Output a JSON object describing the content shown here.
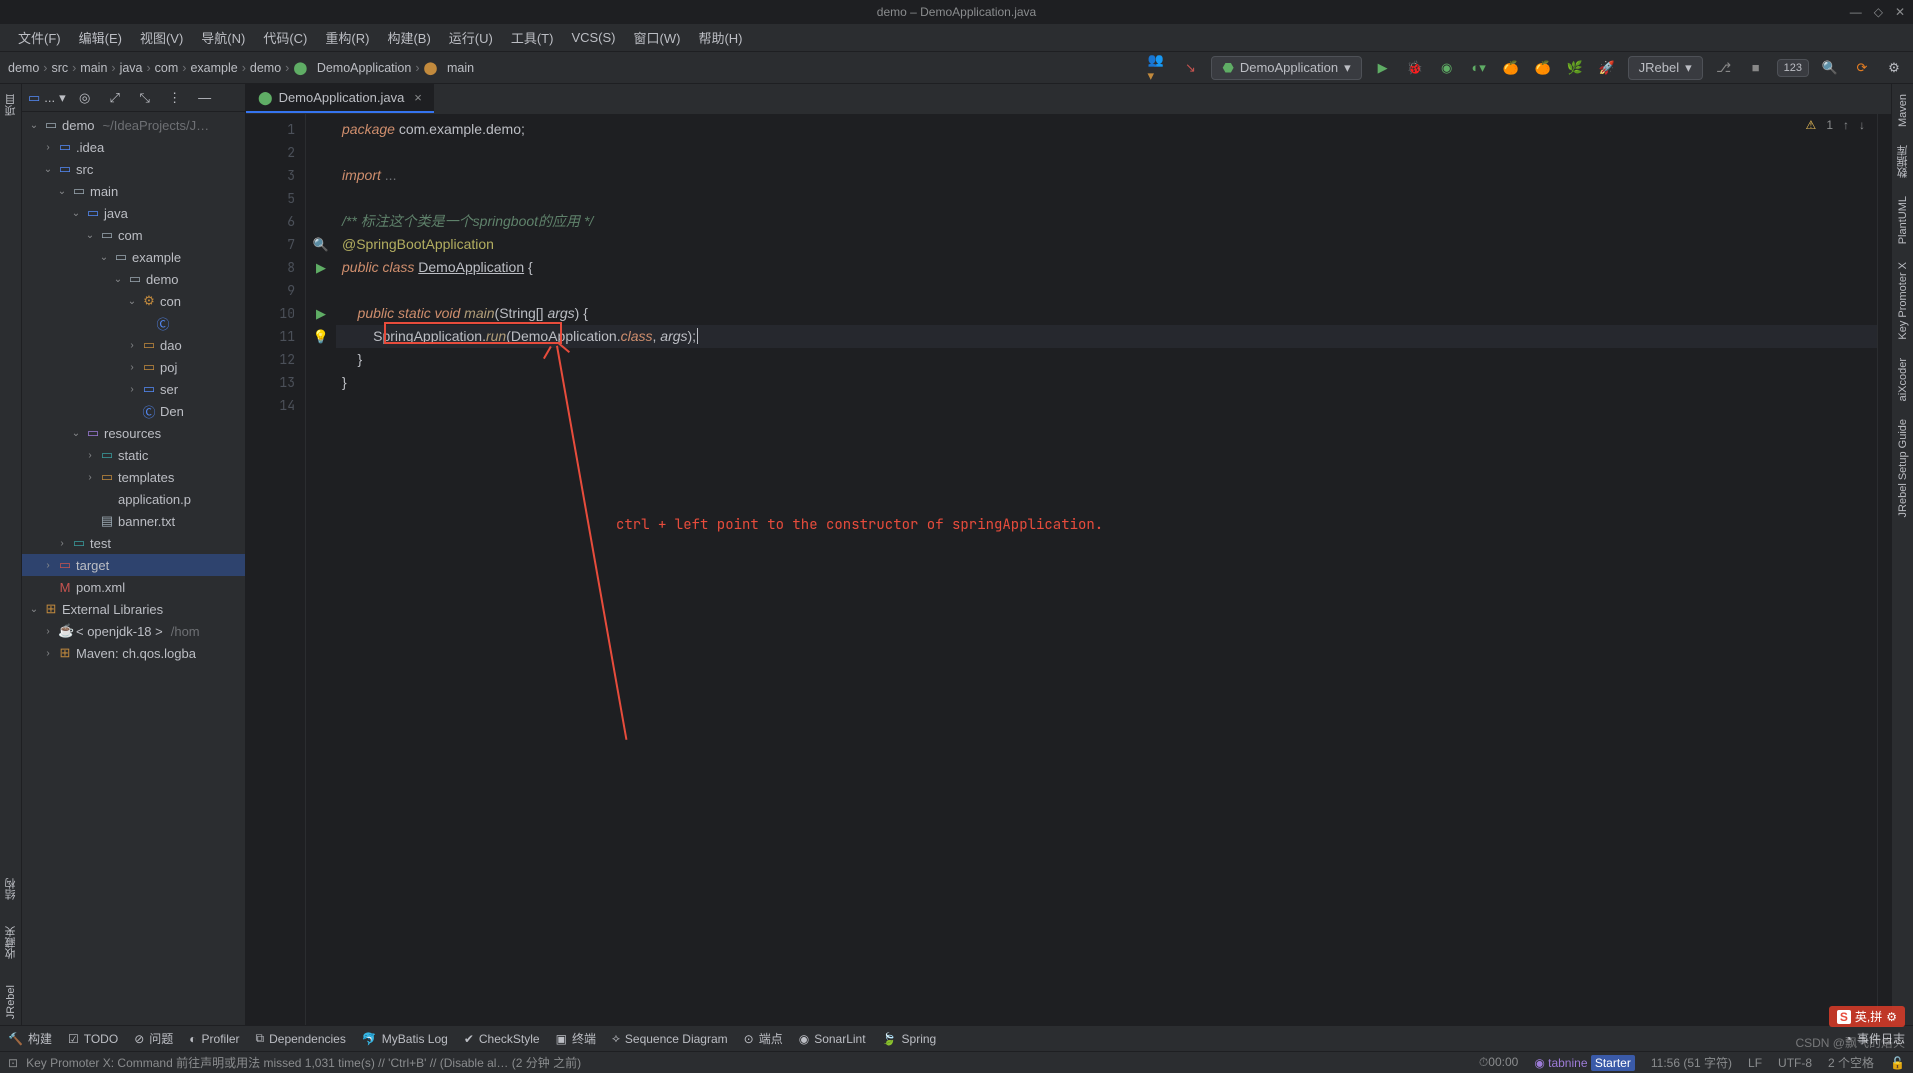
{
  "titlebar": {
    "title": "demo – DemoApplication.java"
  },
  "menu": {
    "file": "文件(F)",
    "edit": "编辑(E)",
    "view": "视图(V)",
    "navigate": "导航(N)",
    "code": "代码(C)",
    "refactor": "重构(R)",
    "build": "构建(B)",
    "run": "运行(U)",
    "tools": "工具(T)",
    "vcs": "VCS(S)",
    "window": "窗口(W)",
    "help": "帮助(H)"
  },
  "breadcrumb": {
    "items": [
      "demo",
      "src",
      "main",
      "java",
      "com",
      "example",
      "demo",
      "DemoApplication",
      "main"
    ]
  },
  "runconfig": {
    "label": "DemoApplication"
  },
  "jrebel": {
    "label": "JRebel"
  },
  "countbadge": {
    "value": "123"
  },
  "project": {
    "header_label": "...",
    "root": {
      "name": "demo",
      "path": "~/IdeaProjects/J…"
    },
    "tree": [
      {
        "indent": 1,
        "arrow": "›",
        "icon": "folder-blue",
        "label": ".idea"
      },
      {
        "indent": 1,
        "arrow": "⌄",
        "icon": "folder-blue",
        "label": "src"
      },
      {
        "indent": 2,
        "arrow": "⌄",
        "icon": "folder",
        "label": "main"
      },
      {
        "indent": 3,
        "arrow": "⌄",
        "icon": "folder-blue",
        "label": "java"
      },
      {
        "indent": 4,
        "arrow": "⌄",
        "icon": "folder",
        "label": "com"
      },
      {
        "indent": 5,
        "arrow": "⌄",
        "icon": "folder",
        "label": "example"
      },
      {
        "indent": 6,
        "arrow": "⌄",
        "icon": "folder",
        "label": "demo"
      },
      {
        "indent": 7,
        "arrow": "⌄",
        "icon": "gear",
        "label": "con"
      },
      {
        "indent": 8,
        "arrow": "",
        "icon": "class",
        "label": ""
      },
      {
        "indent": 7,
        "arrow": "›",
        "icon": "folder-orange",
        "label": "dao"
      },
      {
        "indent": 7,
        "arrow": "›",
        "icon": "folder-orange",
        "label": "poj"
      },
      {
        "indent": 7,
        "arrow": "›",
        "icon": "folder-blue",
        "label": "ser"
      },
      {
        "indent": 7,
        "arrow": "",
        "icon": "class",
        "label": "Den"
      },
      {
        "indent": 3,
        "arrow": "⌄",
        "icon": "folder-purple",
        "label": "resources"
      },
      {
        "indent": 4,
        "arrow": "›",
        "icon": "folder-teal",
        "label": "static"
      },
      {
        "indent": 4,
        "arrow": "›",
        "icon": "folder-orange",
        "label": "templates"
      },
      {
        "indent": 4,
        "arrow": "",
        "icon": "xml",
        "label": "application.p"
      },
      {
        "indent": 4,
        "arrow": "",
        "icon": "file",
        "label": "banner.txt"
      },
      {
        "indent": 2,
        "arrow": "›",
        "icon": "folder-teal",
        "label": "test"
      },
      {
        "indent": 1,
        "arrow": "›",
        "icon": "folder-red",
        "label": "target",
        "selected": true
      },
      {
        "indent": 1,
        "arrow": "",
        "icon": "maven",
        "label": "pom.xml"
      },
      {
        "indent": 0,
        "arrow": "⌄",
        "icon": "lib",
        "label": "External Libraries"
      },
      {
        "indent": 1,
        "arrow": "›",
        "icon": "jdk",
        "label": "< openjdk-18 >",
        "dim": "/hom"
      },
      {
        "indent": 1,
        "arrow": "›",
        "icon": "lib",
        "label": "Maven: ch.qos.logba"
      }
    ]
  },
  "left_stripe": {
    "project": "项目",
    "structure": "结构",
    "favorites": "收藏夹",
    "jrebel": "JRebel"
  },
  "right_stripe": {
    "maven": "Maven",
    "database": "数据库",
    "plantuml": "PlantUML",
    "keypromoter": "Key Promoter X",
    "aixcoder": "aiXcoder",
    "jrebel_setup": "JRebel Setup Guide"
  },
  "editor": {
    "tab_label": "DemoApplication.java",
    "lines": [
      "1",
      "2",
      "3",
      "5",
      "6",
      "7",
      "8",
      "9",
      "10",
      "11",
      "12",
      "13",
      "14"
    ],
    "warning_count": "1",
    "annotation_text": "ctrl + left point to the constructor of springApplication.",
    "code": {
      "l1_kw": "package",
      "l1_rest": " com.example.demo;",
      "l3_kw": "import",
      "l3_rest": " ...",
      "l6_comment": "/** 标注这个类是一个springboot的应用 */",
      "l7_anno": "@SpringBootApplication",
      "l8_a": "public",
      "l8_b": " class ",
      "l8_c": "DemoApplication",
      "l8_d": " {",
      "l10_a": "    public",
      "l10_b": " static",
      "l10_c": " void",
      "l10_d": " main",
      "l10_e": "(String[] ",
      "l10_f": "args",
      "l10_g": ") {",
      "l11_a": "        SpringApplication",
      "l11_b": ".",
      "l11_c": "run",
      "l11_d": "(DemoApplication.",
      "l11_e": "class",
      "l11_f": ", ",
      "l11_g": "args",
      "l11_h": ");",
      "l12": "    }",
      "l13": "}"
    }
  },
  "bottom": {
    "build": "构建",
    "todo": "TODO",
    "problems": "问题",
    "profiler": "Profiler",
    "dependencies": "Dependencies",
    "mybatis": "MyBatis Log",
    "checkstyle": "CheckStyle",
    "terminal": "终端",
    "sequence": "Sequence Diagram",
    "endpoints": "端点",
    "sonarlint": "SonarLint",
    "spring": "Spring",
    "eventlog": "事件日志"
  },
  "status": {
    "message": "Key Promoter X: Command 前往声明或用法 missed 1,031 time(s) // 'Ctrl+B' // (Disable al… (2 分钟 之前)",
    "stopwatch": "00:00",
    "tabnine": "tabnine",
    "tabnine_badge": "Starter",
    "cursor": "11:56 (51 字符)",
    "lf": "LF",
    "encoding": "UTF-8",
    "spaces": "2 个空格"
  },
  "watermark": {
    "ime": "英,拼",
    "csdn": "CSDN @飘飞的烙火"
  }
}
